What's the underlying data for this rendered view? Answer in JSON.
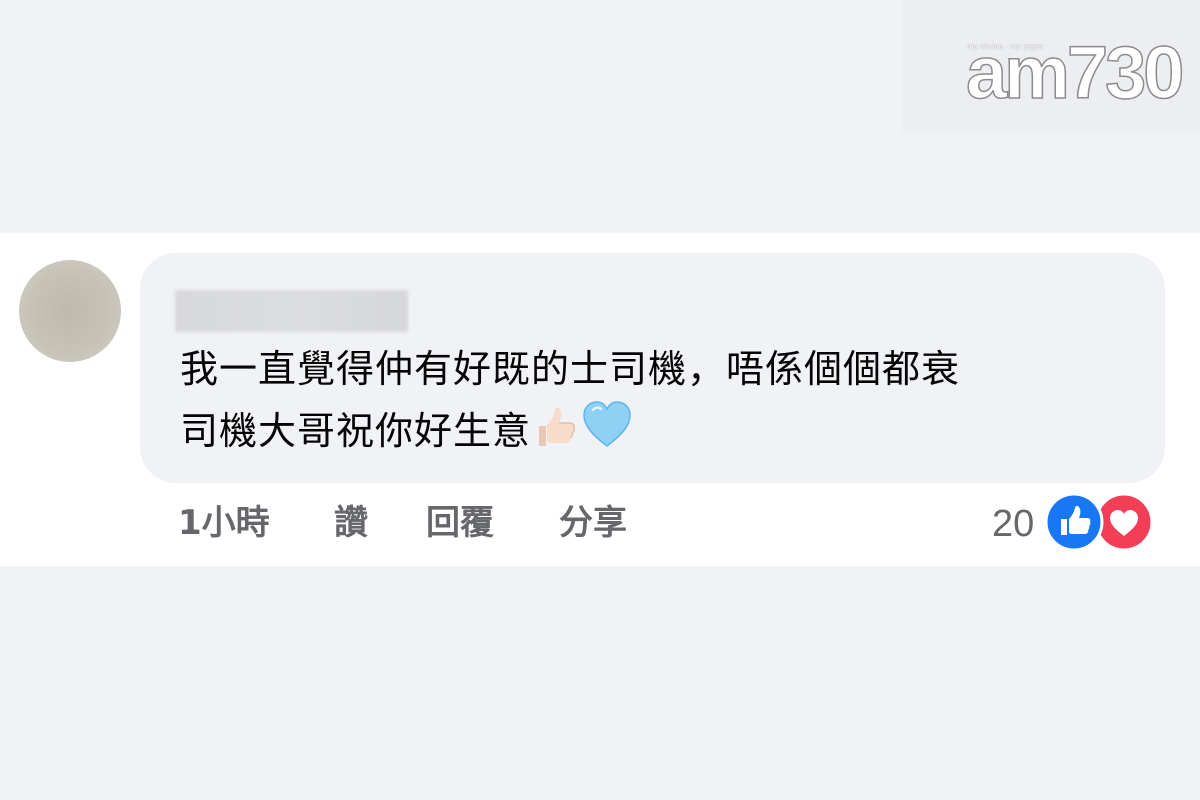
{
  "watermark": {
    "tagline": "my choice · my paper",
    "logo_text": "am730"
  },
  "comment": {
    "author": "",
    "text_lines": [
      "我一直覺得仲有好既的士司機，唔係個個都衰",
      "司機大哥祝你好生意"
    ],
    "emojis": [
      "thumbs-up-light-skin-icon",
      "light-blue-heart-icon"
    ]
  },
  "actions": {
    "time": "1小時",
    "like": "讚",
    "reply": "回覆",
    "share": "分享"
  },
  "reactions": {
    "count": "20",
    "types": [
      "like-reaction-icon",
      "love-reaction-icon"
    ],
    "colors": {
      "like": "#1877f2",
      "love": "#f33e58"
    }
  }
}
